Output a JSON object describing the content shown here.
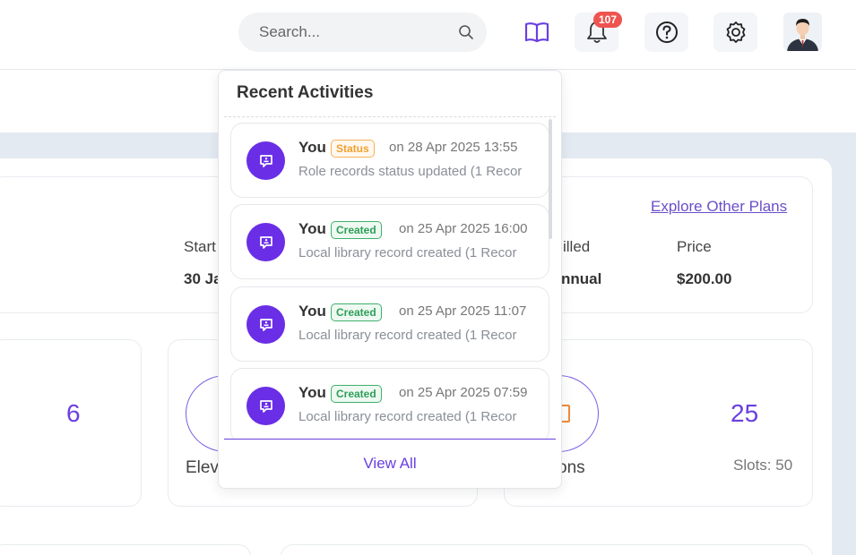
{
  "header": {
    "search_placeholder": "Search...",
    "notification_count": "107",
    "icons": [
      "book-icon",
      "bell-icon",
      "help-icon",
      "settings-icon",
      "avatar"
    ]
  },
  "background": {
    "explore_link": "Explore Other Plans",
    "start_label": "Start",
    "start_value": "30 Ja",
    "billed_label": "illed",
    "billed_value": "nnual",
    "price_label": "Price",
    "price_value": "$200.00",
    "stat1_value": "6",
    "stat2_label": "Elev",
    "stat3_label": "ons",
    "stat3_value": "25",
    "stat3_slots": "Slots: 50"
  },
  "activities": {
    "title": "Recent Activities",
    "items": [
      {
        "who": "You",
        "tag": "Status",
        "tag_type": "status",
        "time": "on 28 Apr 2025 13:55",
        "desc": "Role records status updated (1 Recor"
      },
      {
        "who": "You",
        "tag": "Created",
        "tag_type": "created",
        "time": "on 25 Apr 2025 16:00",
        "desc": "Local library record created (1 Recor"
      },
      {
        "who": "You",
        "tag": "Created",
        "tag_type": "created",
        "time": "on 25 Apr 2025 11:07",
        "desc": "Local library record created (1 Recor"
      },
      {
        "who": "You",
        "tag": "Created",
        "tag_type": "created",
        "time": "on 25 Apr 2025 07:59",
        "desc": "Local library record created (1 Recor"
      }
    ],
    "view_all": "View All"
  },
  "colors": {
    "accent": "#6a2ee6",
    "status_tag": "#f0a030",
    "created_tag": "#2e9e58",
    "badge": "#ef5350"
  }
}
